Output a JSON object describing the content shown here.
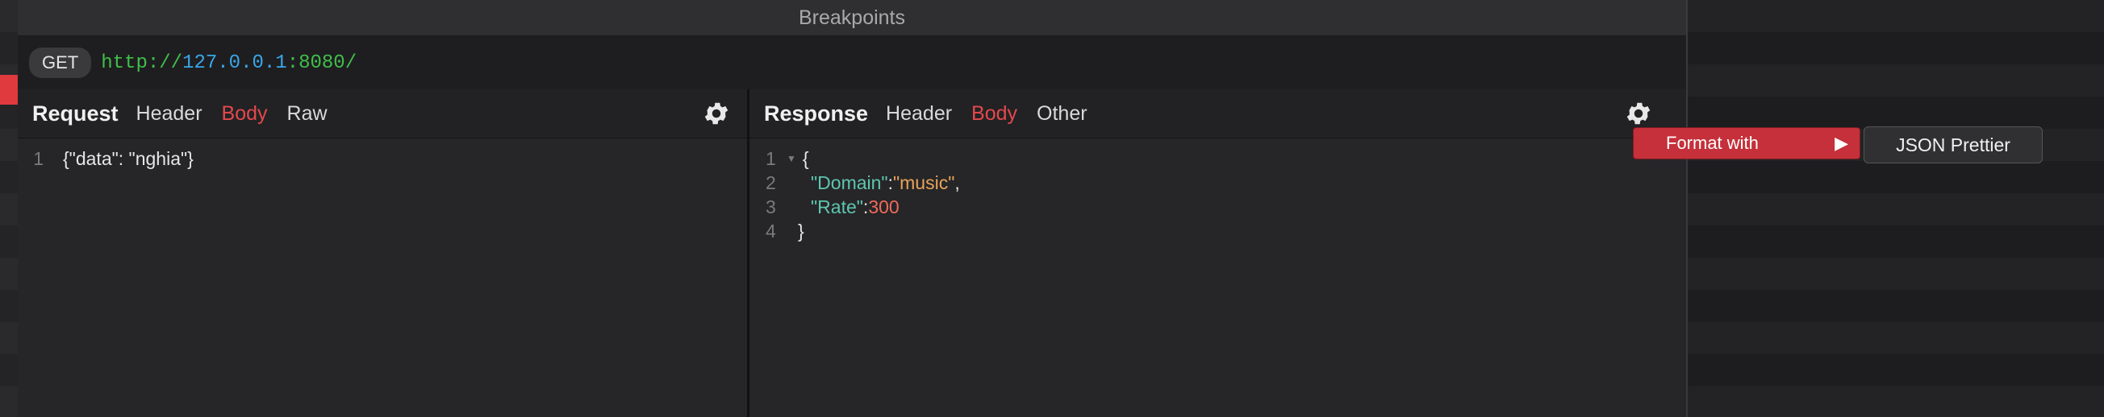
{
  "window": {
    "title": "Breakpoints"
  },
  "request_line": {
    "method": "GET",
    "url": {
      "scheme": "http://",
      "host": "127.0.0.1",
      "port": ":8080/"
    }
  },
  "request": {
    "title": "Request",
    "tabs": [
      "Header",
      "Body",
      "Raw"
    ],
    "active_tab": "Body",
    "lines": [
      {
        "num": "1",
        "text": "{\"data\": \"nghia\"}"
      }
    ]
  },
  "response": {
    "title": "Response",
    "tabs": [
      "Header",
      "Body",
      "Other"
    ],
    "active_tab": "Body",
    "lines": [
      {
        "num": "1",
        "open": "{"
      },
      {
        "num": "2",
        "key": "\"Domain\"",
        "sep": ": ",
        "value": "\"music\"",
        "tail": ","
      },
      {
        "num": "3",
        "key": "\"Rate\"",
        "sep": ": ",
        "value": "300",
        "tail": ""
      },
      {
        "num": "4",
        "close": "}"
      }
    ]
  },
  "context_menu": {
    "item": "Format with",
    "arrow": "▶",
    "submenu_item": "JSON Prettier"
  },
  "colors": {
    "accent": "#e5484d",
    "menu_bg": "#c5303a",
    "key": "#5ec6b0",
    "string": "#e8a25a",
    "number": "#f06a5a"
  }
}
